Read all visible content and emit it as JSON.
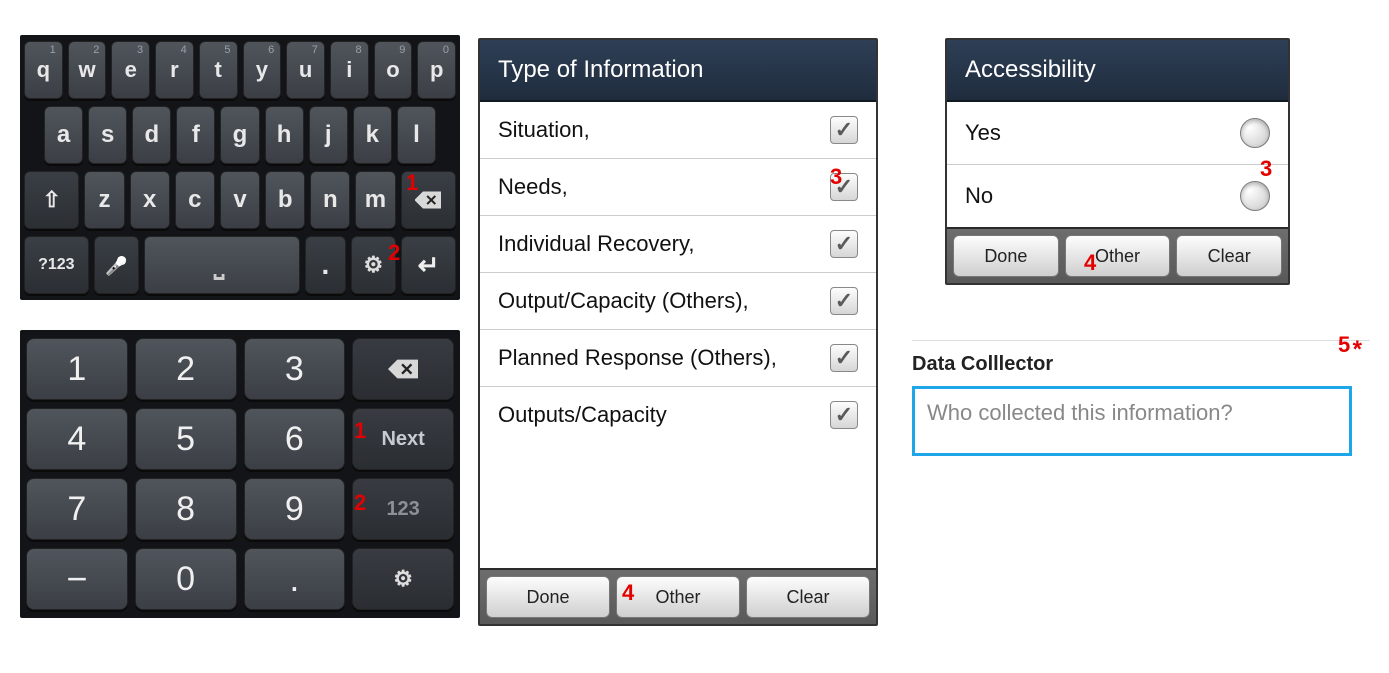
{
  "qwerty": {
    "row1": [
      {
        "k": "q",
        "n": "1"
      },
      {
        "k": "w",
        "n": "2"
      },
      {
        "k": "e",
        "n": "3"
      },
      {
        "k": "r",
        "n": "4"
      },
      {
        "k": "t",
        "n": "5"
      },
      {
        "k": "y",
        "n": "6"
      },
      {
        "k": "u",
        "n": "7"
      },
      {
        "k": "i",
        "n": "8"
      },
      {
        "k": "o",
        "n": "9"
      },
      {
        "k": "p",
        "n": "0"
      }
    ],
    "row2": [
      "a",
      "s",
      "d",
      "f",
      "g",
      "h",
      "j",
      "k",
      "l"
    ],
    "row3": [
      "z",
      "x",
      "c",
      "v",
      "b",
      "n",
      "m"
    ],
    "sym_label": "?123",
    "period": "."
  },
  "numpad": {
    "row1": [
      "1",
      "2",
      "3"
    ],
    "row2": [
      "4",
      "5",
      "6"
    ],
    "row3": [
      "7",
      "8",
      "9"
    ],
    "row4_minus": "−",
    "row4_zero": "0",
    "row4_dot": ".",
    "next_label": "Next",
    "mode_label": "123"
  },
  "checklist": {
    "title": "Type of Information",
    "items": [
      {
        "label": "Situation,",
        "checked": true
      },
      {
        "label": "Needs,",
        "checked": true
      },
      {
        "label": "Individual Recovery,",
        "checked": true
      },
      {
        "label": "Output/Capacity (Others),",
        "checked": true
      },
      {
        "label": "Planned Response (Others),",
        "checked": true
      },
      {
        "label": "Outputs/Capacity",
        "checked": true
      }
    ],
    "footer": {
      "done": "Done",
      "other": "Other",
      "clear": "Clear"
    }
  },
  "radio": {
    "title": "Accessibility",
    "items": [
      {
        "label": "Yes"
      },
      {
        "label": "No"
      }
    ],
    "footer": {
      "done": "Done",
      "other": "Other",
      "clear": "Clear"
    }
  },
  "field": {
    "label": "Data Colllector",
    "placeholder": "Who collected this information?",
    "required_mark": "*"
  },
  "callouts": {
    "q1": "1",
    "q2": "2",
    "n1": "1",
    "n2": "2",
    "chk3": "3",
    "chk4": "4",
    "rad3": "3",
    "rad4": "4",
    "fld5": "5"
  }
}
